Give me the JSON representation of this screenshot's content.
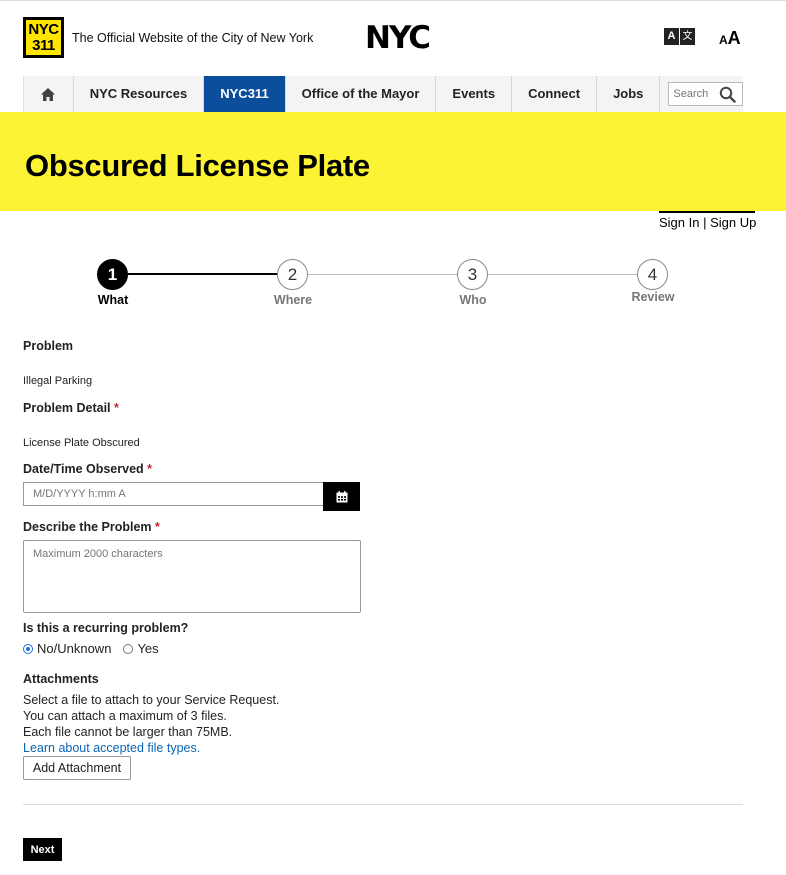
{
  "header": {
    "logo_line1": "NYC",
    "logo_line2": "311",
    "tagline": "The Official Website of the City of New York",
    "city_logo": "NYC",
    "translate_icon_a": "A",
    "translate_icon_b": "文",
    "textsize_small": "A",
    "textsize_large": "A"
  },
  "nav": {
    "items": [
      {
        "label": "NYC Resources"
      },
      {
        "label": "NYC311"
      },
      {
        "label": "Office of the Mayor"
      },
      {
        "label": "Events"
      },
      {
        "label": "Connect"
      },
      {
        "label": "Jobs"
      }
    ],
    "active_index": 1,
    "active_color": "#0b4f9c",
    "search_placeholder": "Search"
  },
  "banner": {
    "title": "Obscured License Plate",
    "color": "#fcf335"
  },
  "account": {
    "sign_in": "Sign In",
    "separator": "|",
    "sign_up": "Sign Up"
  },
  "stepper": {
    "steps": [
      {
        "number": "1",
        "label": "What",
        "active": true
      },
      {
        "number": "2",
        "label": "Where",
        "active": false
      },
      {
        "number": "3",
        "label": "Who",
        "active": false
      },
      {
        "number": "4",
        "label": "Review",
        "active": false
      }
    ]
  },
  "form": {
    "problem_label": "Problem",
    "problem_value": "Illegal Parking",
    "problem_detail_label": "Problem Detail",
    "problem_detail_value": "License Plate Obscured",
    "date_label": "Date/Time Observed",
    "date_placeholder": "M/D/YYYY h:mm A",
    "describe_label": "Describe the Problem",
    "describe_placeholder": "Maximum 2000 characters",
    "required_mark": "*",
    "recurring_label": "Is this a recurring problem?",
    "recurring_options": [
      "No/Unknown",
      "Yes"
    ],
    "recurring_selected": "No/Unknown",
    "attachments_label": "Attachments",
    "attachments_line1": "Select a file to attach to your Service Request.",
    "attachments_line2": "You can attach a maximum of 3 files.",
    "attachments_line3": "Each file cannot be larger than 75MB.",
    "attachments_link": "Learn about accepted file types.",
    "add_attachment_button": "Add Attachment",
    "next_button": "Next"
  }
}
